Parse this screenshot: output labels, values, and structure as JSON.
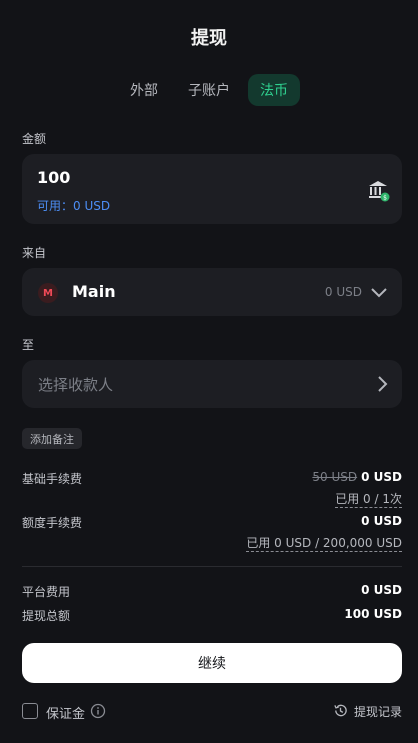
{
  "header": {
    "title": "提现"
  },
  "tabs": [
    {
      "label": "外部",
      "active": false
    },
    {
      "label": "子账户",
      "active": false
    },
    {
      "label": "法币",
      "active": true
    }
  ],
  "amount": {
    "label": "金额",
    "value": "100",
    "available": "可用：0 USD",
    "icon": "bank-icon"
  },
  "from": {
    "label": "来自",
    "badge": "M",
    "account": "Main",
    "balance": "0 USD"
  },
  "to": {
    "label": "至",
    "placeholder": "选择收款人"
  },
  "add_note": "添加备注",
  "fees": {
    "base_label": "基础手续费",
    "base_original": "50 USD",
    "base_value": "0 USD",
    "base_usage": "已用 0 / 1次",
    "quota_label": "额度手续费",
    "quota_value": "0 USD",
    "quota_usage": "已用 0 USD / 200,000 USD"
  },
  "summary": {
    "platform_label": "平台费用",
    "platform_value": "0 USD",
    "total_label": "提现总额",
    "total_value": "100 USD"
  },
  "continue_label": "继续",
  "footer": {
    "deposit_label": "保证金",
    "history_label": "提现记录"
  },
  "colors": {
    "background": "#121317",
    "accent_green": "#2fd08f",
    "link_blue": "#4d8ef5"
  }
}
